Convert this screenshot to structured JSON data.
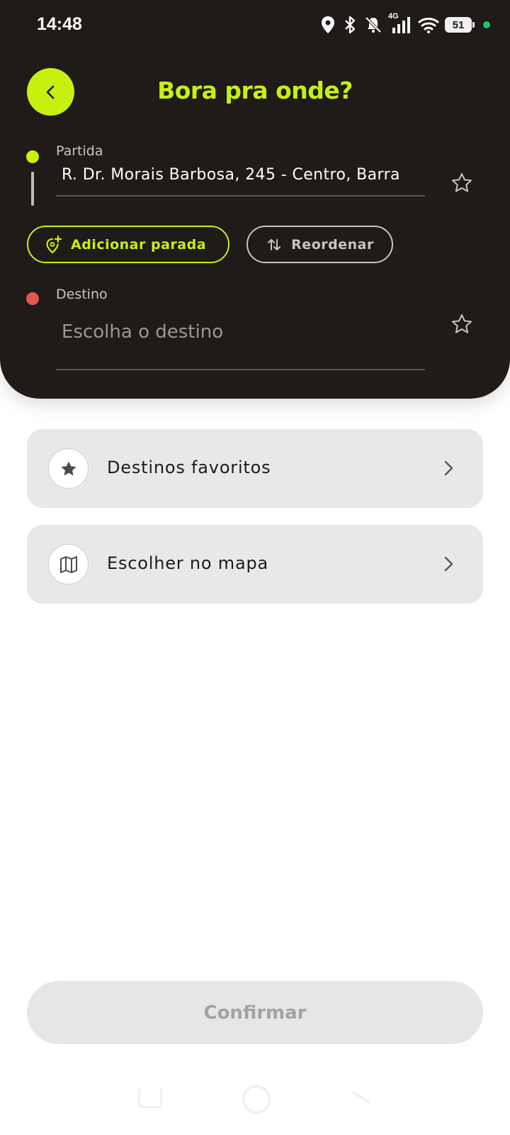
{
  "status_bar": {
    "time": "14:48",
    "network": "4G",
    "battery": "51",
    "icons": [
      "location-icon",
      "bluetooth-icon",
      "mute-icon",
      "signal-icon",
      "wifi-icon",
      "battery-icon"
    ]
  },
  "header": {
    "title": "Bora pra onde?",
    "back_icon": "chevron-left-icon"
  },
  "origin": {
    "label": "Partida",
    "value": "R. Dr. Morais Barbosa, 245 - Centro, Barra"
  },
  "actions": {
    "add_stop_label": "Adicionar parada",
    "reorder_label": "Reordenar"
  },
  "destination": {
    "label": "Destino",
    "placeholder": "Escolha o destino"
  },
  "options": [
    {
      "label": "Destinos favoritos",
      "icon": "star-icon"
    },
    {
      "label": "Escolher no mapa",
      "icon": "map-icon"
    }
  ],
  "confirm_label": "Confirmar",
  "colors": {
    "accent": "#c6f110",
    "header_bg": "#201a18",
    "destination_dot": "#e4574e",
    "card_bg": "#e8e8e8"
  }
}
